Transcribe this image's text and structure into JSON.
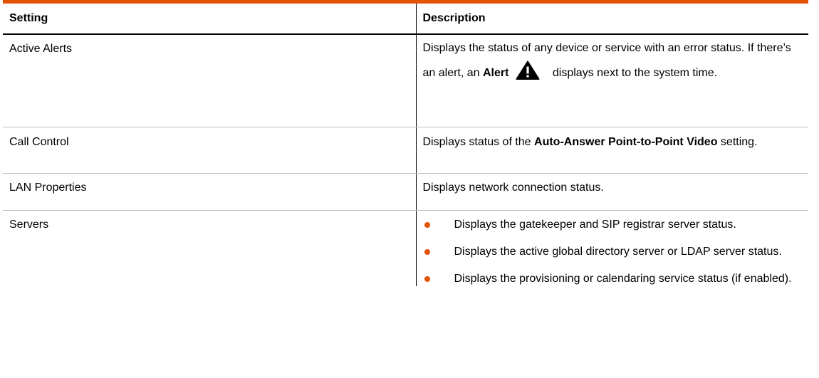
{
  "table": {
    "headers": {
      "setting": "Setting",
      "description": "Description"
    },
    "rows": {
      "active_alerts": {
        "setting": "Active Alerts",
        "desc_part1": "Displays the status of any device or service with an error status. If there’s an alert, an ",
        "desc_bold": "Alert",
        "desc_part2": " displays next to the system time.",
        "icon": "warning-triangle-icon"
      },
      "call_control": {
        "setting": "Call Control",
        "desc_part1": "Displays status of the ",
        "desc_bold": "Auto-Answer Point-to-Point Video",
        "desc_part2": " setting."
      },
      "lan_properties": {
        "setting": "LAN Properties",
        "desc": "Displays network connection status."
      },
      "servers": {
        "setting": "Servers",
        "bullets": [
          "Displays the gatekeeper and SIP registrar server status.",
          "Displays the active global directory server or LDAP server status.",
          "Displays the provisioning or calendaring service status (if enabled)."
        ]
      }
    },
    "colors": {
      "accent": "#e35205",
      "rule": "#bdbdbd",
      "text": "#000000"
    }
  }
}
